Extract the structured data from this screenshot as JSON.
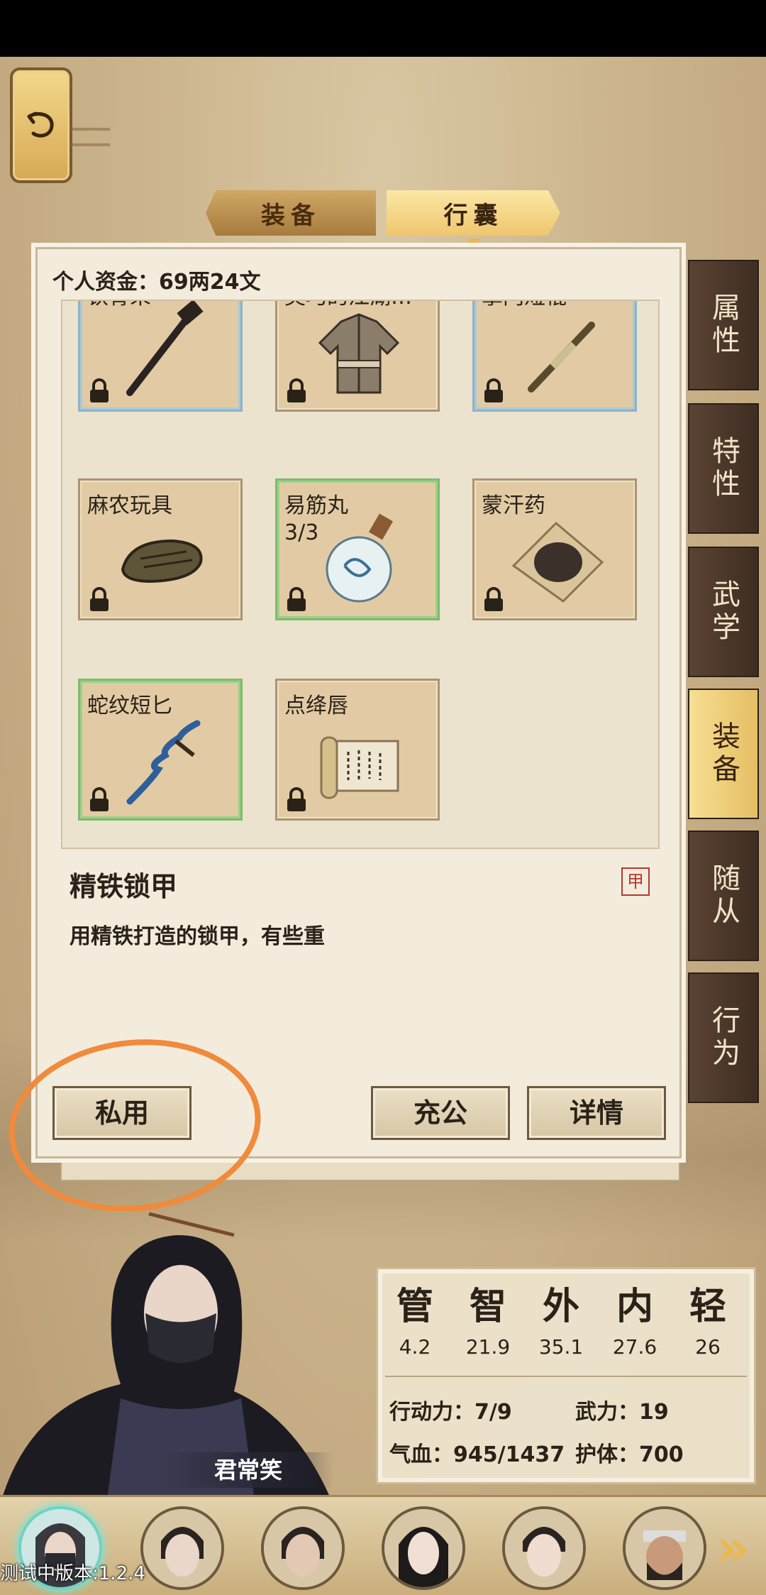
{
  "header": {
    "back_icon": "undo-arrow-icon"
  },
  "tabs": [
    {
      "label": "装备",
      "active": false
    },
    {
      "label": "行囊",
      "active": true
    }
  ],
  "funds": {
    "text": "个人资金：69两24文"
  },
  "items": [
    {
      "name": "铁骨朵",
      "count": "",
      "border": "blue",
      "icon": "iron-club-icon",
      "locked": true
    },
    {
      "name": "灵巧的江湖…",
      "count": "",
      "border": "plain",
      "icon": "robe-icon",
      "locked": true
    },
    {
      "name": "掌门短棍",
      "count": "",
      "border": "blue",
      "icon": "staff-icon",
      "locked": true
    },
    {
      "name": "麻农玩具",
      "count": "",
      "border": "plain",
      "icon": "toy-icon",
      "locked": true
    },
    {
      "name": "易筋丸",
      "count": "3/3",
      "border": "green",
      "icon": "porcelain-bottle-icon",
      "locked": true
    },
    {
      "name": "蒙汗药",
      "count": "",
      "border": "plain",
      "icon": "powder-packet-icon",
      "locked": true
    },
    {
      "name": "蛇纹短匕",
      "count": "",
      "border": "green",
      "icon": "serpent-dagger-icon",
      "locked": true
    },
    {
      "name": "点绛唇",
      "count": "",
      "border": "plain",
      "icon": "scroll-icon",
      "locked": true
    }
  ],
  "description": {
    "title": "精铁锁甲",
    "tag": "甲",
    "text": "用精铁打造的锁甲，有些重"
  },
  "buttons": {
    "private": "私用",
    "public": "充公",
    "detail": "详情"
  },
  "side_tabs": [
    {
      "label": "属性",
      "active": false
    },
    {
      "label": "特性",
      "active": false
    },
    {
      "label": "武学",
      "active": false
    },
    {
      "label": "装备",
      "active": true
    },
    {
      "label": "随从",
      "active": false
    },
    {
      "label": "行为",
      "active": false
    }
  ],
  "character": {
    "name": "君常笑"
  },
  "stats": {
    "attributes": [
      {
        "key": "管",
        "value": "4.2"
      },
      {
        "key": "智",
        "value": "21.9"
      },
      {
        "key": "外",
        "value": "35.1"
      },
      {
        "key": "内",
        "value": "27.6"
      },
      {
        "key": "轻",
        "value": "26"
      }
    ],
    "action_power": "行动力：7/9",
    "force": "武力：19",
    "hp": "气血：945/1437",
    "guard": "护体：700"
  },
  "roster": {
    "next_icon": "double-chevron-right-icon"
  },
  "version": "测试中版本:1.2.4",
  "colors": {
    "accent_gold": "#efc66e",
    "side_tab_dark": "#4a3629",
    "highlight_orange": "#f08a3c",
    "lock_tag_red": "#b33a2c"
  }
}
